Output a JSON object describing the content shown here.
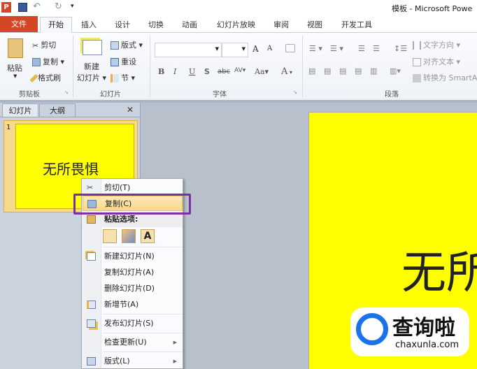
{
  "window": {
    "title": "模板 - Microsoft PowerPoint",
    "title_visible": "模板 - Microsoft Powe"
  },
  "qat": {
    "app_icon": "P",
    "save": "save-icon",
    "undo": "undo-icon",
    "redo": "redo-icon",
    "customize": "▾"
  },
  "tabs": [
    {
      "label": "文件"
    },
    {
      "label": "开始"
    },
    {
      "label": "插入"
    },
    {
      "label": "设计"
    },
    {
      "label": "切换"
    },
    {
      "label": "动画"
    },
    {
      "label": "幻灯片放映"
    },
    {
      "label": "审阅"
    },
    {
      "label": "视图"
    },
    {
      "label": "开发工具"
    }
  ],
  "ribbon": {
    "clipboard": {
      "label": "剪贴板",
      "paste": "粘贴",
      "cut": "剪切",
      "copy": "复制",
      "format_painter": "格式刷"
    },
    "slides": {
      "label": "幻灯片",
      "new_slide_1": "新建",
      "new_slide_2": "幻灯片",
      "layout": "版式",
      "reset": "重设",
      "section": "节"
    },
    "font": {
      "label": "字体",
      "font_name": "",
      "font_size": "",
      "bold": "B",
      "italic": "I",
      "underline": "U",
      "strike": "S",
      "abc": "abc",
      "spacing": "AV",
      "case": "Aa",
      "color": "A",
      "grow": "A",
      "shrink": "A"
    },
    "paragraph": {
      "label": "段落",
      "text_direction": "文字方向",
      "align_text": "对齐文本",
      "smartart": "转换为 SmartArt"
    }
  },
  "pane": {
    "tabs": [
      "幻灯片",
      "大纲"
    ],
    "close": "✕",
    "slide_number": "1",
    "thumb_text": "无所畏惧"
  },
  "slide": {
    "text_visible": "无所"
  },
  "context_menu": {
    "items": [
      {
        "label": "剪切(T)",
        "icon": "scissors-icon"
      },
      {
        "label": "复制(C)",
        "icon": "copy-icon",
        "highlighted": true
      },
      {
        "label": "粘贴选项:",
        "icon": "paste-icon"
      },
      {
        "label": "新建幻灯片(N)",
        "icon": "new-slide-icon"
      },
      {
        "label": "复制幻灯片(A)"
      },
      {
        "label": "删除幻灯片(D)"
      },
      {
        "label": "新增节(A)",
        "icon": "section-icon"
      },
      {
        "label": "发布幻灯片(S)",
        "icon": "publish-icon"
      },
      {
        "label": "检查更新(U)",
        "submenu": true
      },
      {
        "label": "版式(L)",
        "icon": "layout-icon",
        "submenu": true
      }
    ],
    "paste_options": [
      "use-destination-theme",
      "keep-source-formatting",
      "keep-text-only"
    ],
    "paste_text_only_glyph": "A",
    "highlight_color": "#7b2fa0"
  },
  "watermark": {
    "brand": "查询啦",
    "domain": "chaxunla.com",
    "color": "#1a73e8"
  },
  "colors": {
    "slide": "#ffff00",
    "file_tab": "#d24726"
  }
}
